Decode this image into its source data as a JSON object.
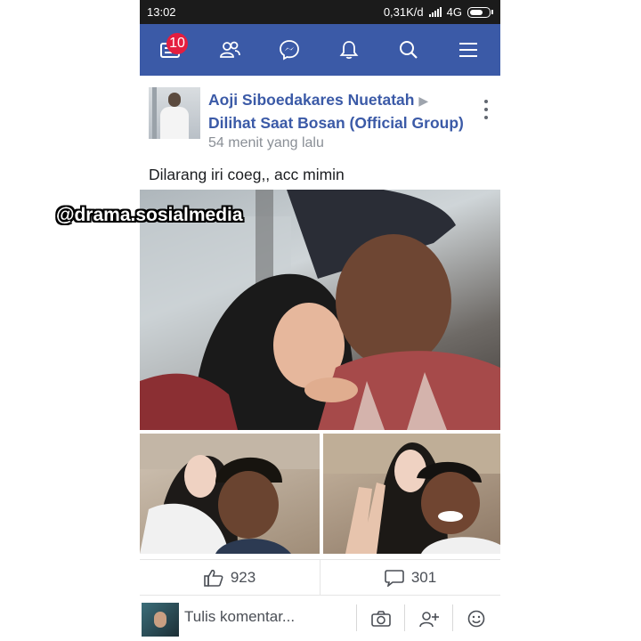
{
  "status_bar": {
    "time": "13:02",
    "speed": "0,31K/d",
    "network": "4G"
  },
  "navbar": {
    "notification_count": "10",
    "icons": [
      "news-feed-icon",
      "friends-icon",
      "messenger-icon",
      "bell-icon",
      "search-icon",
      "menu-icon"
    ],
    "color": "#3b5aa7"
  },
  "post": {
    "author": "Aoji Siboedakares Nuetatah",
    "arrow": "▶",
    "group": "Dilihat Saat Bosan (Official Group)",
    "time_ago": "54 menit yang lalu",
    "caption": "Dilarang iri coeg,,  acc mimin",
    "watermark": "@drama.sosialmedia",
    "likes": "923",
    "comments": "301"
  },
  "composer": {
    "placeholder": "Tulis komentar..."
  }
}
